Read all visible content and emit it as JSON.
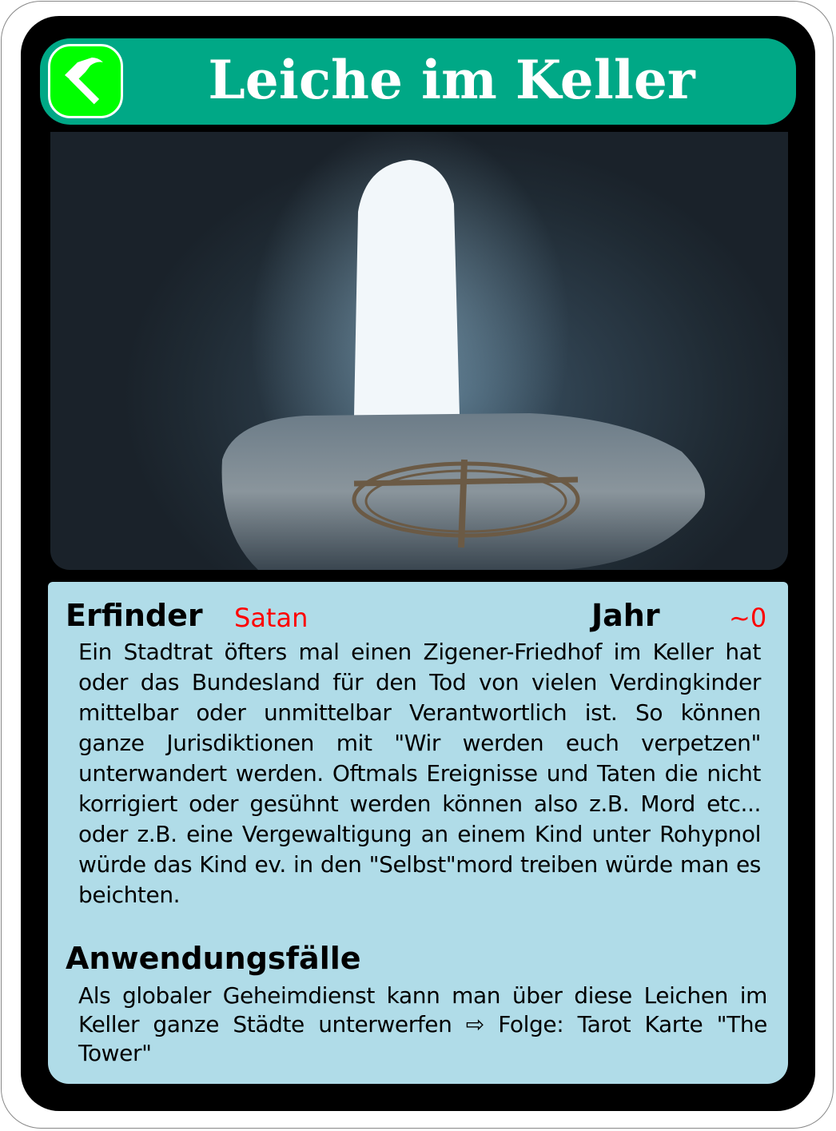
{
  "card": {
    "title": "Leiche im Keller",
    "category_icon": "hammer-icon",
    "inventor_label": "Erfinder",
    "inventor_value": "Satan",
    "year_label": "Jahr",
    "year_value": "~0",
    "description": "Ein Stadtrat öfters mal einen Zigener-Friedhof im Keller hat oder das Bundesland für den Tod von vielen Verdingkinder mittelbar oder unmittelbar Verantwortlich ist. So können ganze Jurisdiktionen mit \"Wir werden euch verpetzen\" unterwandert werden. Oftmals Ereignisse und Taten die nicht korrigiert oder gesühnt werden können also z.B. Mord etc... oder z.B. eine Vergewaltigung an einem Kind unter Rohypnol würde das Kind ev. in den \"Selbst\"mord treiben würde man es beichten.",
    "use_cases_label": "Anwendungsfälle",
    "use_cases": "Als globaler Geheimdienst kann man über diese Leichen im Keller ganze Städte unterwerfen ⇨ Folge: Tarot Karte \"The Tower\""
  },
  "colors": {
    "header": "#00a886",
    "badge": "#00ff00",
    "panel": "#b0dce8",
    "accent": "#ff0000"
  }
}
